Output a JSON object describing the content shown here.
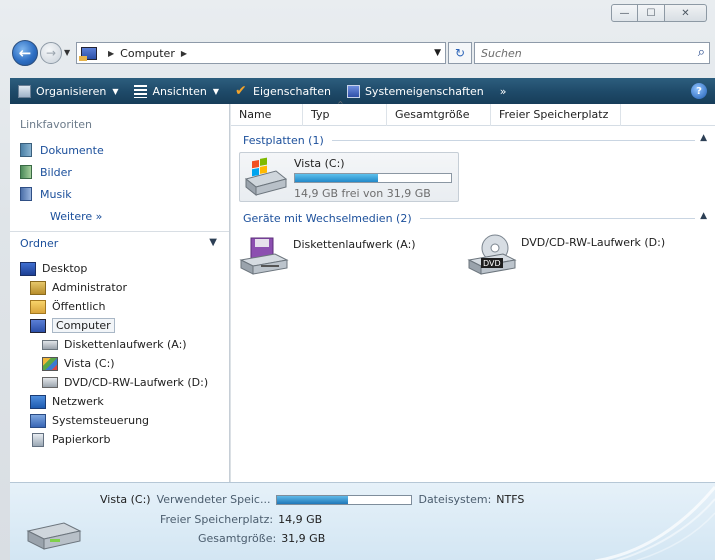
{
  "window": {
    "caption": {
      "minimize": "—",
      "maximize": "☐",
      "close": "✕"
    }
  },
  "address": {
    "breadcrumb": [
      "Computer"
    ],
    "search_placeholder": "Suchen"
  },
  "toolbar": {
    "items": [
      {
        "label": "Organisieren",
        "icon": "organize-icon",
        "dropdown": true
      },
      {
        "label": "Ansichten",
        "icon": "views-icon",
        "dropdown": true
      },
      {
        "label": "Eigenschaften",
        "icon": "checkmark-icon",
        "dropdown": false
      },
      {
        "label": "Systemeigenschaften",
        "icon": "system-properties-icon",
        "dropdown": false
      }
    ],
    "overflow": "»",
    "help": "?"
  },
  "favorites": {
    "header": "Linkfavoriten",
    "items": [
      "Dokumente",
      "Bilder",
      "Musik"
    ],
    "more": "Weitere »"
  },
  "folders": {
    "header": "Ordner",
    "tree": [
      {
        "label": "Desktop",
        "icon": "desktop-icon",
        "level": 0
      },
      {
        "label": "Administrator",
        "icon": "user-folder-icon",
        "level": 1
      },
      {
        "label": "Öffentlich",
        "icon": "folder-icon",
        "level": 1
      },
      {
        "label": "Computer",
        "icon": "computer-icon",
        "level": 1,
        "selected": true
      },
      {
        "label": "Diskettenlaufwerk (A:)",
        "icon": "floppy-drive-icon",
        "level": 2
      },
      {
        "label": "Vista (C:)",
        "icon": "hard-drive-icon",
        "level": 2
      },
      {
        "label": "DVD/CD-RW-Laufwerk (D:)",
        "icon": "dvd-drive-icon",
        "level": 2
      },
      {
        "label": "Netzwerk",
        "icon": "network-icon",
        "level": 1
      },
      {
        "label": "Systemsteuerung",
        "icon": "control-panel-icon",
        "level": 1
      },
      {
        "label": "Papierkorb",
        "icon": "recycle-bin-icon",
        "level": 1
      }
    ]
  },
  "columns": [
    "Name",
    "Typ",
    "Gesamtgröße",
    "Freier Speicherplatz"
  ],
  "groups": {
    "hard_disks": "Festplatten (1)",
    "removable": "Geräte mit Wechselmedien (2)"
  },
  "drives": {
    "c": {
      "name": "Vista (C:)",
      "free_text": "14,9 GB frei von 31,9 GB",
      "used_fraction": 0.53
    },
    "a": {
      "name": "Diskettenlaufwerk (A:)"
    },
    "d": {
      "name": "DVD/CD-RW-Laufwerk (D:)",
      "badge": "DVD"
    }
  },
  "details": {
    "name": "Vista (C:)",
    "used_label": "Verwendeter Speic...",
    "fs_label": "Dateisystem:",
    "fs_value": "NTFS",
    "free_label": "Freier Speicherplatz:",
    "free_value": "14,9 GB",
    "total_label": "Gesamtgröße:",
    "total_value": "31,9 GB",
    "used_fraction": 0.53
  },
  "colors": {
    "toolbar_top": "#2d5e7e",
    "toolbar_bottom": "#173d59",
    "link_blue": "#1b4f9b",
    "bar_fill": "#2288c9"
  }
}
